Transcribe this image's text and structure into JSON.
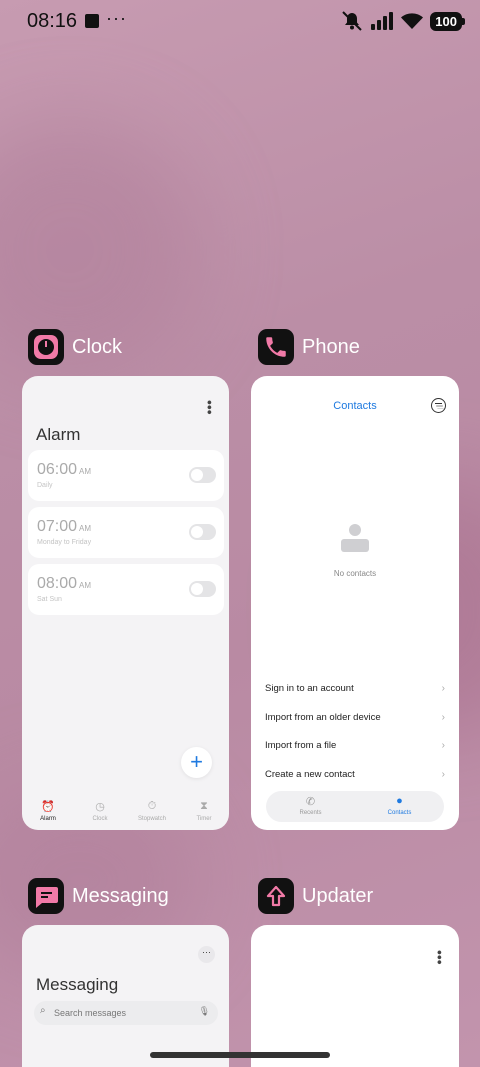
{
  "status_bar": {
    "time": "08:16",
    "battery": "100"
  },
  "apps": {
    "clock": {
      "name": "Clock",
      "title": "Alarm",
      "alarms": [
        {
          "time": "06:00",
          "ampm": "AM",
          "repeat": "Daily"
        },
        {
          "time": "07:00",
          "ampm": "AM",
          "repeat": "Monday to Friday"
        },
        {
          "time": "08:00",
          "ampm": "AM",
          "repeat": "Sat Sun"
        }
      ],
      "add_label": "+",
      "tabs": [
        "Alarm",
        "Clock",
        "Stopwatch",
        "Timer"
      ],
      "active_tab": "Alarm"
    },
    "phone": {
      "name": "Phone",
      "title": "Contacts",
      "empty_text": "No contacts",
      "options": [
        "Sign in to an account",
        "Import from an older device",
        "Import from a file",
        "Create a new contact"
      ],
      "tabs": [
        "Recents",
        "Contacts"
      ],
      "active_tab": "Contacts"
    },
    "messaging": {
      "name": "Messaging",
      "title": "Messaging",
      "search_placeholder": "Search messages"
    },
    "updater": {
      "name": "Updater"
    }
  },
  "colors": {
    "accent": "#1f7ae0",
    "icon_pink": "#f17aa7"
  }
}
